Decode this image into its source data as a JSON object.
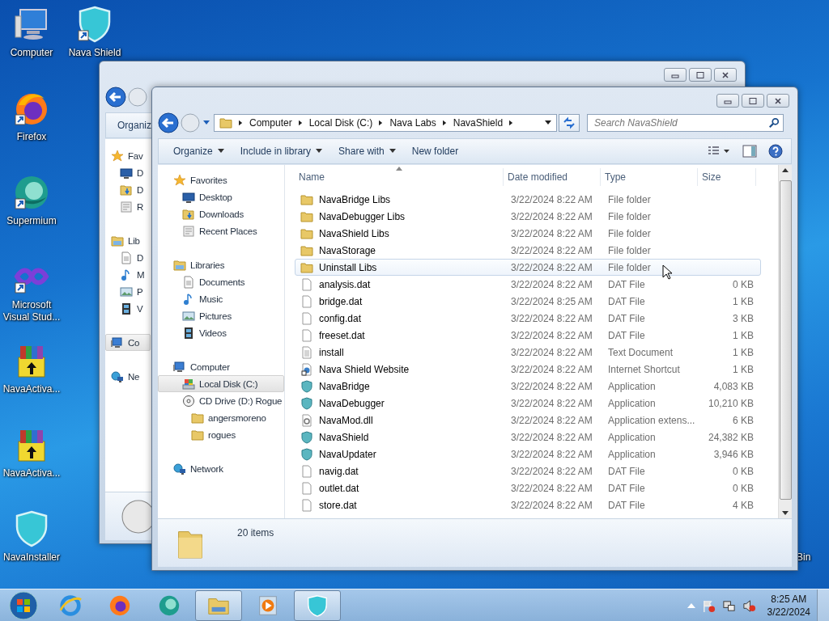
{
  "desktop_icons": [
    {
      "label": "Computer",
      "kind": "computer",
      "shortcut": false
    },
    {
      "label": "Nava Shield",
      "kind": "shield",
      "shortcut": true
    },
    {
      "label": "Firefox",
      "kind": "firefox",
      "shortcut": true
    },
    {
      "label": "Supermium",
      "kind": "supermium",
      "shortcut": true
    },
    {
      "label": "Microsoft Visual Stud...",
      "kind": "vs",
      "shortcut": true
    },
    {
      "label": "NavaActiva...",
      "kind": "archive",
      "shortcut": false
    },
    {
      "label": "NavaActiva...",
      "kind": "archive",
      "shortcut": false
    },
    {
      "label": "NavaInstaller",
      "kind": "shield",
      "shortcut": false
    }
  ],
  "recycle_bin": {
    "label": "Bin"
  },
  "back_window": {
    "toolbar": "Organiz",
    "nav": [
      {
        "label": "Fav",
        "kind": "favorites",
        "selected": false,
        "children": [
          {
            "label": "D",
            "kind": "desktop",
            "selected": false
          },
          {
            "label": "D",
            "kind": "downloads",
            "selected": false
          },
          {
            "label": "R",
            "kind": "recent",
            "selected": false
          }
        ]
      },
      {
        "label": "Lib",
        "kind": "libraries",
        "selected": false,
        "children": [
          {
            "label": "D",
            "kind": "documents",
            "selected": false
          },
          {
            "label": "M",
            "kind": "music",
            "selected": false
          },
          {
            "label": "P",
            "kind": "pictures",
            "selected": false
          },
          {
            "label": "V",
            "kind": "videos",
            "selected": false
          }
        ]
      },
      {
        "label": "Co",
        "kind": "computer",
        "selected": true
      },
      {
        "label": "Ne",
        "kind": "network",
        "selected": false
      }
    ]
  },
  "window": {
    "address": [
      "Computer",
      "Local Disk (C:)",
      "Nava Labs",
      "NavaShield"
    ],
    "search": {
      "placeholder": "Search NavaShield"
    },
    "toolbar": [
      {
        "label": "Organize",
        "menu": true
      },
      {
        "label": "Include in library",
        "menu": true
      },
      {
        "label": "Share with",
        "menu": true
      },
      {
        "label": "New folder",
        "menu": false
      }
    ],
    "nav": [
      {
        "label": "Favorites",
        "kind": "favorites",
        "selected": false,
        "children": [
          {
            "label": "Desktop",
            "kind": "desktop",
            "selected": false
          },
          {
            "label": "Downloads",
            "kind": "downloads",
            "selected": false
          },
          {
            "label": "Recent Places",
            "kind": "recent",
            "selected": false
          }
        ]
      },
      {
        "label": "Libraries",
        "kind": "libraries",
        "selected": false,
        "children": [
          {
            "label": "Documents",
            "kind": "documents",
            "selected": false
          },
          {
            "label": "Music",
            "kind": "music",
            "selected": false
          },
          {
            "label": "Pictures",
            "kind": "pictures",
            "selected": false
          },
          {
            "label": "Videos",
            "kind": "videos",
            "selected": false
          }
        ]
      },
      {
        "label": "Computer",
        "kind": "computer",
        "selected": false,
        "children": [
          {
            "label": "Local Disk (C:)",
            "kind": "disk",
            "selected": true
          },
          {
            "label": "CD Drive (D:) Rogue",
            "kind": "cd",
            "selected": false,
            "children": [
              {
                "label": "angersmoreno",
                "kind": "folder",
                "selected": false
              },
              {
                "label": "rogues",
                "kind": "folder",
                "selected": false
              }
            ]
          }
        ]
      },
      {
        "label": "Network",
        "kind": "network",
        "selected": false
      }
    ],
    "columns": [
      {
        "label": "Name",
        "sorted": true
      },
      {
        "label": "Date modified",
        "sorted": false
      },
      {
        "label": "Type",
        "sorted": false
      },
      {
        "label": "Size",
        "sorted": false
      }
    ],
    "rows": [
      {
        "name": "NavaBridge Libs",
        "date": "3/22/2024 8:22 AM",
        "type": "File folder",
        "size": "",
        "kind": "folder",
        "hovered": false
      },
      {
        "name": "NavaDebugger Libs",
        "date": "3/22/2024 8:22 AM",
        "type": "File folder",
        "size": "",
        "kind": "folder",
        "hovered": false
      },
      {
        "name": "NavaShield Libs",
        "date": "3/22/2024 8:22 AM",
        "type": "File folder",
        "size": "",
        "kind": "folder",
        "hovered": false
      },
      {
        "name": "NavaStorage",
        "date": "3/22/2024 8:22 AM",
        "type": "File folder",
        "size": "",
        "kind": "folder",
        "hovered": false
      },
      {
        "name": "Uninstall Libs",
        "date": "3/22/2024 8:22 AM",
        "type": "File folder",
        "size": "",
        "kind": "folder",
        "hovered": true
      },
      {
        "name": "analysis.dat",
        "date": "3/22/2024 8:22 AM",
        "type": "DAT File",
        "size": "0 KB",
        "kind": "file",
        "hovered": false
      },
      {
        "name": "bridge.dat",
        "date": "3/22/2024 8:25 AM",
        "type": "DAT File",
        "size": "1 KB",
        "kind": "file",
        "hovered": false
      },
      {
        "name": "config.dat",
        "date": "3/22/2024 8:22 AM",
        "type": "DAT File",
        "size": "3 KB",
        "kind": "file",
        "hovered": false
      },
      {
        "name": "freeset.dat",
        "date": "3/22/2024 8:22 AM",
        "type": "DAT File",
        "size": "1 KB",
        "kind": "file",
        "hovered": false
      },
      {
        "name": "install",
        "date": "3/22/2024 8:22 AM",
        "type": "Text Document",
        "size": "1 KB",
        "kind": "text",
        "hovered": false
      },
      {
        "name": "Nava Shield Website",
        "date": "3/22/2024 8:22 AM",
        "type": "Internet Shortcut",
        "size": "1 KB",
        "kind": "link",
        "hovered": false
      },
      {
        "name": "NavaBridge",
        "date": "3/22/2024 8:22 AM",
        "type": "Application",
        "size": "4,083 KB",
        "kind": "app",
        "hovered": false
      },
      {
        "name": "NavaDebugger",
        "date": "3/22/2024 8:22 AM",
        "type": "Application",
        "size": "10,210 KB",
        "kind": "app",
        "hovered": false
      },
      {
        "name": "NavaMod.dll",
        "date": "3/22/2024 8:22 AM",
        "type": "Application extens...",
        "size": "6 KB",
        "kind": "dll",
        "hovered": false
      },
      {
        "name": "NavaShield",
        "date": "3/22/2024 8:22 AM",
        "type": "Application",
        "size": "24,382 KB",
        "kind": "app",
        "hovered": false
      },
      {
        "name": "NavaUpdater",
        "date": "3/22/2024 8:22 AM",
        "type": "Application",
        "size": "3,946 KB",
        "kind": "app",
        "hovered": false
      },
      {
        "name": "navig.dat",
        "date": "3/22/2024 8:22 AM",
        "type": "DAT File",
        "size": "0 KB",
        "kind": "file",
        "hovered": false
      },
      {
        "name": "outlet.dat",
        "date": "3/22/2024 8:22 AM",
        "type": "DAT File",
        "size": "0 KB",
        "kind": "file",
        "hovered": false
      },
      {
        "name": "store.dat",
        "date": "3/22/2024 8:22 AM",
        "type": "DAT File",
        "size": "4 KB",
        "kind": "file",
        "hovered": false
      }
    ],
    "details": {
      "count": "20 items"
    }
  },
  "taskbar": {
    "items": [
      {
        "kind": "ie",
        "active": false
      },
      {
        "kind": "firefox",
        "active": false
      },
      {
        "kind": "supermium",
        "active": false
      },
      {
        "kind": "explorer",
        "active": true
      },
      {
        "kind": "media",
        "active": false
      },
      {
        "kind": "shield",
        "active": true
      }
    ],
    "time": "8:25 AM",
    "date": "3/22/2024"
  }
}
